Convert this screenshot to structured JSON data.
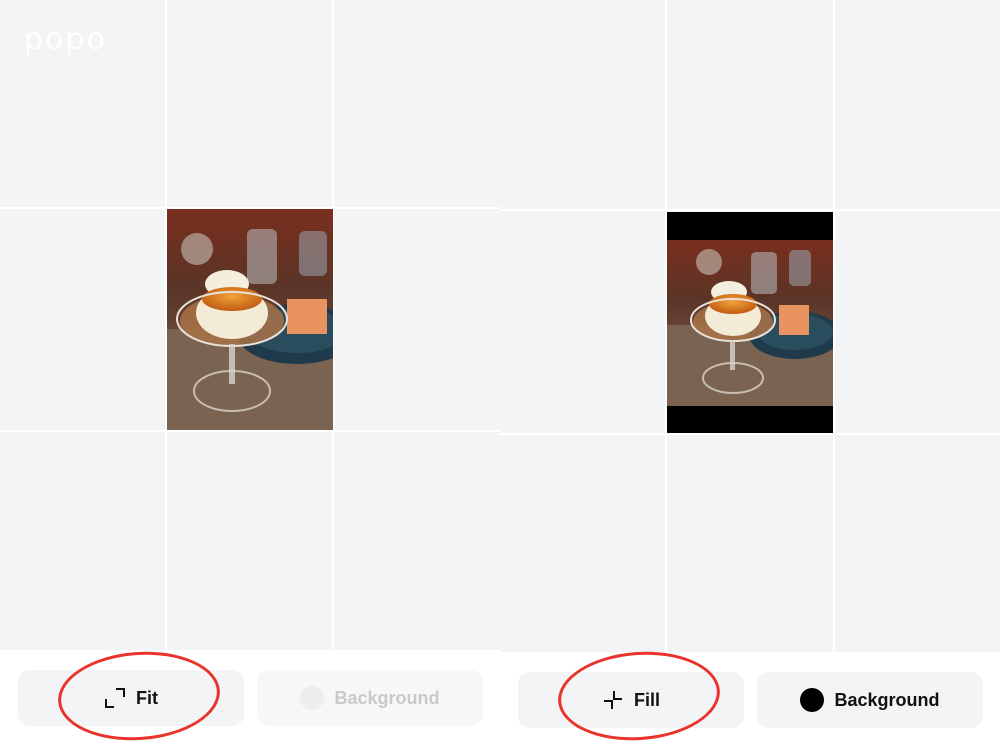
{
  "left_panel": {
    "watermark": "popo",
    "mode_button_label": "Fit",
    "background_button_label": "Background",
    "mode_icon": "expand-corners-icon",
    "background_swatch": "#000000"
  },
  "right_panel": {
    "mode_button_label": "Fill",
    "background_button_label": "Background",
    "mode_icon": "collapse-corners-icon",
    "background_swatch": "#000000"
  },
  "colors": {
    "canvas_bg": "#f3f4f6",
    "grid_line": "#ffffff",
    "button_bg": "#f3f4f6",
    "annotation_red": "#e8342c",
    "letterbox": "#000000"
  }
}
